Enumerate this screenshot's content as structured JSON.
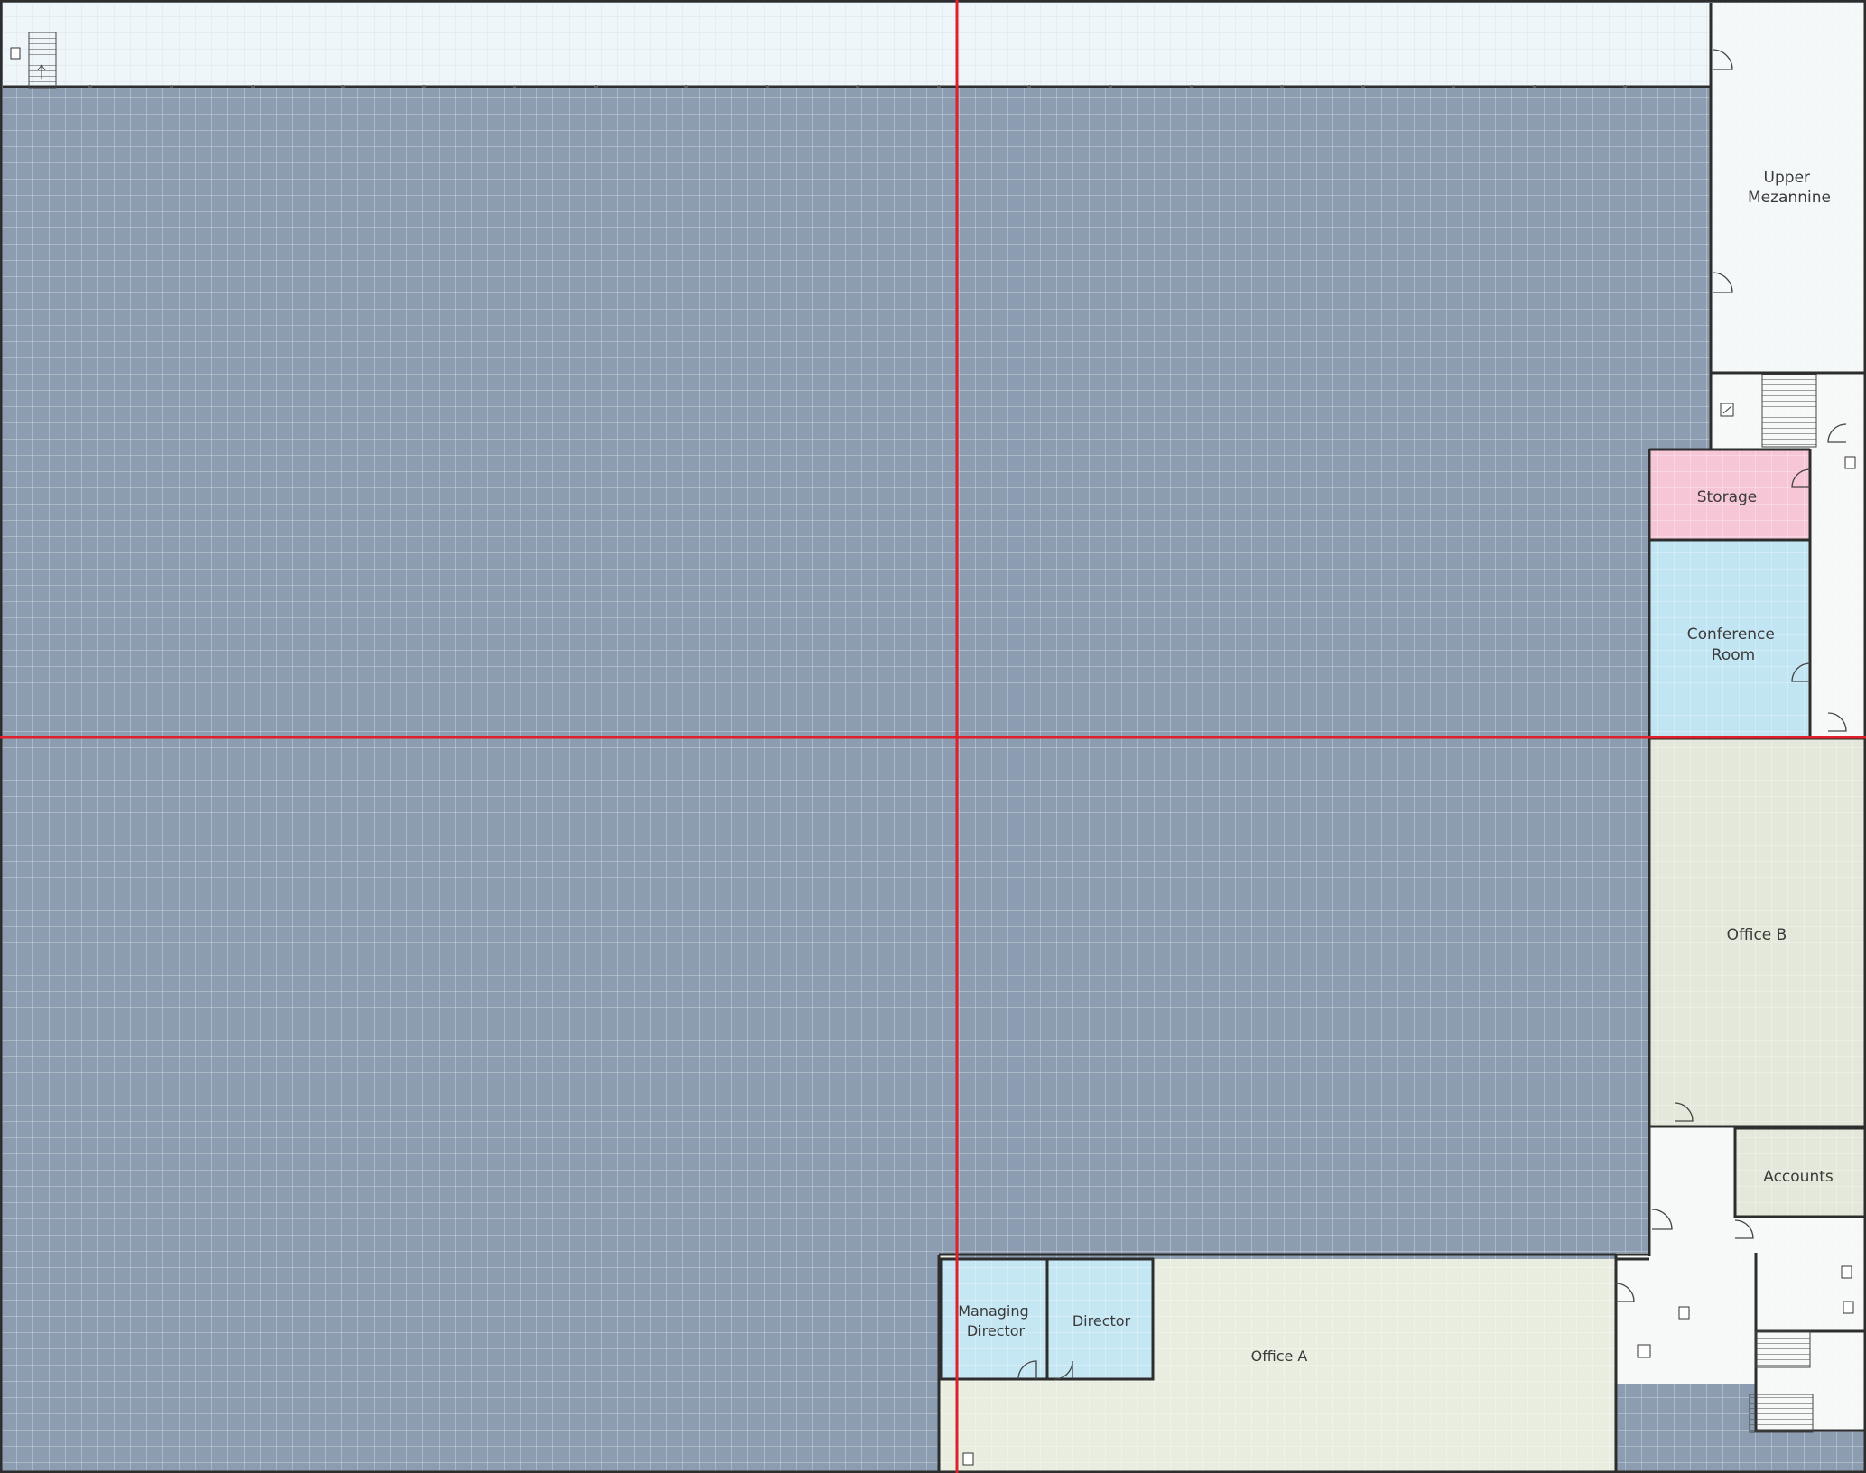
{
  "rooms": {
    "upper_mezzanine": [
      "Upper",
      "Mezannine"
    ],
    "storage": "Storage",
    "conference_room": [
      "Conference",
      "Room"
    ],
    "office_b": "Office B",
    "accounts": "Accounts",
    "managing_director": [
      "Managing",
      "Director"
    ],
    "director": "Director",
    "office_a": "Office A"
  },
  "colors": {
    "warehouse_floor": "#8d9db1",
    "mezzanine": "#eef6fa",
    "storage": "#f6c6d6",
    "conference": "#c2e5f4",
    "office": "#e3e8da",
    "office_a": "#e8eddf",
    "director_rooms": "#c5e6f3",
    "white_rooms": "#f7f9f9",
    "grid": "#ffffff",
    "walls": "#2d2d2d",
    "crosshair": "#e0202b"
  }
}
